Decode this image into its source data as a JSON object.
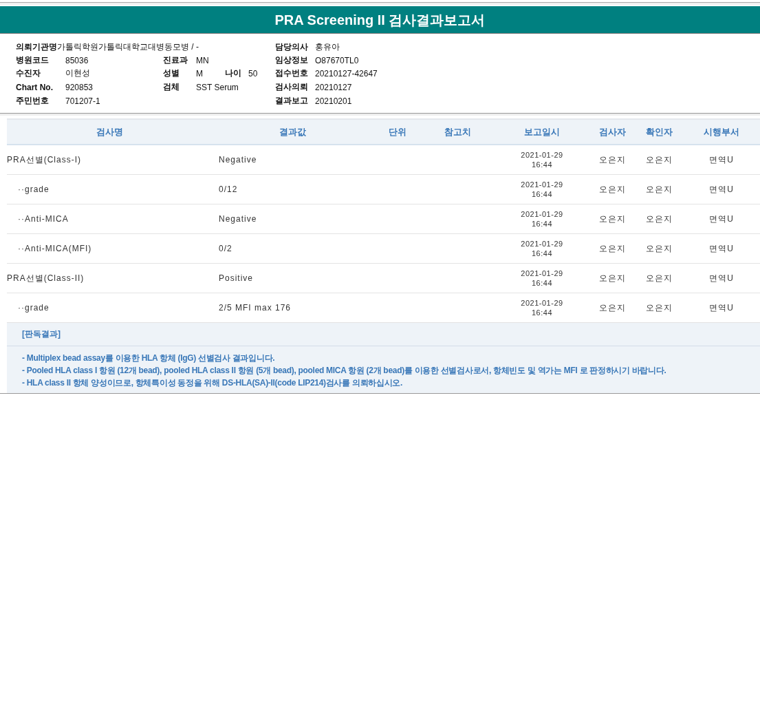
{
  "title": "PRA Screening II 검사결과보고서",
  "info_rows": [
    {
      "left": {
        "label": "의뢰기관명",
        "value": "가톨릭학원가톨릭대학교대병동모병 / -"
      },
      "middle": [],
      "right": {
        "label": "담당의사",
        "value": "홍유아"
      }
    },
    {
      "left": {
        "label": "병원코드",
        "value": "85036"
      },
      "middle": [
        {
          "label": "진료과",
          "value": "MN"
        }
      ],
      "right": {
        "label": "임상정보",
        "value": "O87670TL0"
      }
    },
    {
      "left": {
        "label": "수진자",
        "value": "이현성"
      },
      "middle": [
        {
          "label": "성별",
          "value": "M"
        },
        {
          "label": "나이",
          "value": "50"
        }
      ],
      "right": {
        "label": "접수번호",
        "value": "20210127-42647"
      }
    },
    {
      "left": {
        "label": "Chart No.",
        "value": "920853"
      },
      "middle": [
        {
          "label": "검체",
          "value": "SST Serum"
        }
      ],
      "right": {
        "label": "검사의뢰",
        "value": "20210127"
      }
    },
    {
      "left": {
        "label": "주민번호",
        "value": "701207-1"
      },
      "middle": [],
      "right": {
        "label": "결과보고",
        "value": "20210201"
      }
    }
  ],
  "table": {
    "columns": [
      "검사명",
      "결과값",
      "단위",
      "참고치",
      "보고일시",
      "검사자",
      "확인자",
      "시행부서"
    ],
    "rows": [
      {
        "name": "PRA선별(Class-I)",
        "result": "Negative",
        "date": "2021-01-29",
        "time": "16:44",
        "tester": "오은지",
        "confirmer": "오은지",
        "dept": "면역U",
        "children": [
          {
            "name": "··grade",
            "result": "0/12",
            "date": "2021-01-29",
            "time": "16:44",
            "tester": "오은지",
            "confirmer": "오은지",
            "dept": "면역U"
          },
          {
            "name": "··Anti-MICA",
            "result": "Negative",
            "date": "2021-01-29",
            "time": "16:44",
            "tester": "오은지",
            "confirmer": "오은지",
            "dept": "면역U"
          },
          {
            "name": "··Anti-MICA(MFI)",
            "result": "0/2",
            "date": "2021-01-29",
            "time": "16:44",
            "tester": "오은지",
            "confirmer": "오은지",
            "dept": "면역U"
          }
        ]
      },
      {
        "name": "PRA선별(Class-II)",
        "result": "Positive",
        "date": "2021-01-29",
        "time": "16:44",
        "tester": "오은지",
        "confirmer": "오은지",
        "dept": "면역U",
        "children": [
          {
            "name": "··grade",
            "result": "2/5 MFI max 176",
            "date": "2021-01-29",
            "time": "16:44",
            "tester": "오은지",
            "confirmer": "오은지",
            "dept": "면역U"
          }
        ]
      }
    ]
  },
  "interpretation": {
    "heading": "[판독결과]",
    "lines": [
      "- Multiplex bead assay를 이용한 HLA 항체 (IgG) 선별검사 결과입니다.",
      "- Pooled HLA class I 항원 (12개 bead), pooled HLA class II 항원 (5개 bead), pooled MICA 항원 (2개 bead)를 이용한 선별검사로서, 항체빈도 및 역가는 MFI 로 판정하시기 바랍니다.",
      "- HLA class II 항체 양성이므로, 항체특이성 동정을 위해 DS-HLA(SA)-II(code LIP214)검사를 의뢰하십시오."
    ]
  }
}
